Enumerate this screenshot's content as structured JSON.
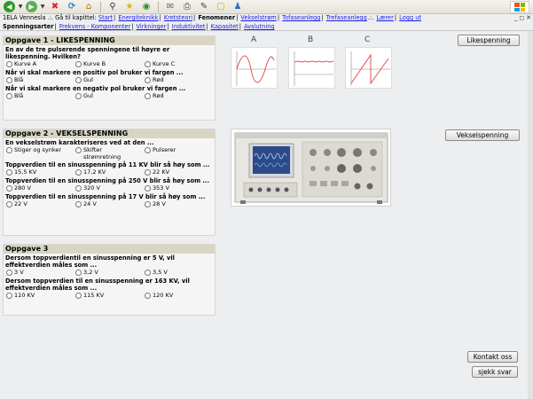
{
  "nav": {
    "prefix": "1ELA Vennesla .:. Gå til kapittel:",
    "items": [
      "Start",
      "Energiteknikk",
      "Kretsteori",
      "Fenomener",
      "Vekselstrøm",
      "Tofaseanlegg",
      "Trefaseanlegg",
      "Lærer",
      "Logg ut"
    ],
    "current": "Fenomener",
    "separator": "|",
    "tail_sep": ".:."
  },
  "subnav": {
    "items": [
      "Spenningsarter",
      "Frekvens - Komponenter",
      "Virkninger",
      "Induktivitet",
      "Kapasitet",
      "Avslutning"
    ],
    "current": "Spenningsarter"
  },
  "oppgave1": {
    "title": "Oppgave 1 - LIKESPENNING",
    "questions": [
      {
        "text": "En av de tre pulserende spenningene til høyre er likespenning. Hvilken?",
        "options": [
          "Kurve A",
          "Kurve B",
          "Kurve C"
        ]
      },
      {
        "text": "Når vi skal markere en positiv pol bruker vi fargen ...",
        "options": [
          "Blå",
          "Gul",
          "Rød"
        ]
      },
      {
        "text": "Når vi skal markere en negativ pol bruker vi fargen ...",
        "options": [
          "Blå",
          "Gul",
          "Rød"
        ]
      }
    ]
  },
  "oppgave2": {
    "title": "Oppgave 2 - VEKSELSPENNING",
    "questions": [
      {
        "text": "En vekselstrøm karakteriseres ved at den ...",
        "options": [
          "Stiger og synker",
          "Skifter strømretning",
          "Pulserer"
        ]
      },
      {
        "text": "Toppverdien til en sinusspenning på 11 KV blir så høy som ...",
        "options": [
          "15,5 KV",
          "17,2 KV",
          "22 KV"
        ]
      },
      {
        "text": "Toppverdien til en sinusspenning på 250 V blir så høy som ...",
        "options": [
          "280 V",
          "320 V",
          "353 V"
        ]
      },
      {
        "text": "Toppverdien til en sinusspenning på 17 V blir så høy som ...",
        "options": [
          "22 V",
          "24 V",
          "28 V"
        ]
      }
    ]
  },
  "oppgave3": {
    "title": "Oppgave 3",
    "questions": [
      {
        "text": "Dersom toppverdientil en sinusspenning er 5 V, vil effektverdien måles som ...",
        "options": [
          "3 V",
          "3,2 V",
          "3,5 V"
        ]
      },
      {
        "text": "Dersom toppverdien til en sinusspenning er 163 KV, vil effektverdien måles som ...",
        "options": [
          "110 KV",
          "115 KV",
          "120 KV"
        ]
      }
    ]
  },
  "curves": {
    "a": "A",
    "b": "B",
    "c": "C"
  },
  "buttons": {
    "likespenning": "Likespenning",
    "vekselspenning": "Vekselspenning",
    "kontakt": "Kontakt oss",
    "sjekk": "sjekk svar"
  },
  "colors": {
    "panel_header": "#d8d6c2",
    "link": "#1a1ae6",
    "curve": "#e05050",
    "scope_screen": "#2a4a8a"
  }
}
